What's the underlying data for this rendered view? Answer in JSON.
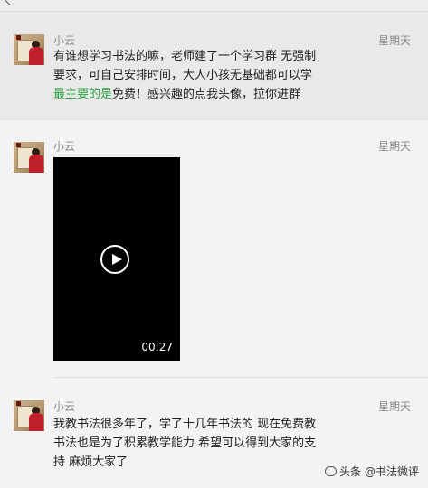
{
  "messages": [
    {
      "name": "小云",
      "day": "星期天",
      "lines": [
        "有谁想学习书法的嘛，老师建了一个学习群 无强制",
        "要求，可自己安排时间，大人小孩无基础都可以学"
      ],
      "highlight": "最主要的是",
      "tail": "免费！感兴趣的点我头像，拉你进群"
    },
    {
      "name": "小云",
      "day": "星期天",
      "video": {
        "duration": "00:27"
      }
    },
    {
      "name": "小云",
      "day": "星期天",
      "text": "我教书法很多年了，学了十几年书法的 现在免费教\n书法也是为了积累教学能力 希望可以得到大家的支\n持 麻烦大家了"
    }
  ],
  "watermark": "头条 @书法微评"
}
